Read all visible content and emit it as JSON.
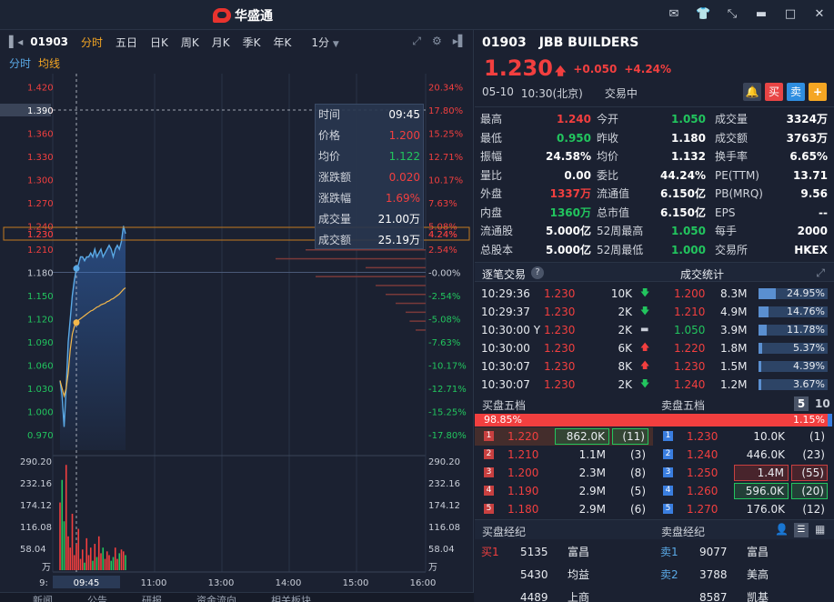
{
  "app": {
    "brand": "华盛通"
  },
  "window_icons": [
    "mail-icon",
    "shirt-icon",
    "shrink-icon",
    "minimize-icon",
    "maximize-icon",
    "close-icon"
  ],
  "toolbar": {
    "code": "01903",
    "tabs": [
      "分时",
      "五日",
      "日K",
      "周K",
      "月K",
      "季K",
      "年K"
    ],
    "active_tab": "分时",
    "interval": "1分"
  },
  "subtabs": {
    "primary": "分时",
    "secondary": "均线"
  },
  "tooltip": [
    {
      "k": "时间",
      "v": "09:45",
      "color": "#ffffff"
    },
    {
      "k": "价格",
      "v": "1.200",
      "color": "#f23f3f"
    },
    {
      "k": "均价",
      "v": "1.122",
      "color": "#22c55e"
    },
    {
      "k": "涨跌额",
      "v": "0.020",
      "color": "#f23f3f"
    },
    {
      "k": "涨跌幅",
      "v": "1.69%",
      "color": "#f23f3f"
    },
    {
      "k": "成交量",
      "v": "21.00万",
      "color": "#ffffff"
    },
    {
      "k": "成交额",
      "v": "25.19万",
      "color": "#ffffff"
    }
  ],
  "chart_data": {
    "type": "line",
    "title": "",
    "prev_close": 1.18,
    "ylim": [
      0.95,
      1.43
    ],
    "y_ticks_left": [
      "1.420",
      "1.390",
      "1.360",
      "1.330",
      "1.300",
      "1.270",
      "1.240",
      "1.230",
      "1.210",
      "1.180",
      "1.150",
      "1.120",
      "1.090",
      "1.060",
      "1.030",
      "1.000",
      "0.970"
    ],
    "y_ticks_right": [
      "20.34%",
      "17.80%",
      "15.25%",
      "12.71%",
      "10.17%",
      "7.63%",
      "5.08%",
      "4.24%",
      "2.54%",
      "-0.00%",
      "-2.54%",
      "-5.08%",
      "-7.63%",
      "-10.17%",
      "-12.71%",
      "-15.25%",
      "-17.80%"
    ],
    "x_ticks": [
      "9:",
      "09:45",
      "11:00",
      "13:00",
      "14:00",
      "15:00",
      "16:00"
    ],
    "crosshair_time": "09:45",
    "crosshair_price": "1.390",
    "last_price_label": "1.230",
    "last_pct_label": "4.24%",
    "series": [
      {
        "name": "价格",
        "values": [
          1.04,
          1.02,
          0.98,
          1.03,
          1.09,
          1.12,
          1.15,
          1.17,
          1.185,
          1.19,
          1.2,
          1.2,
          1.195,
          1.2,
          1.2,
          1.205,
          1.2,
          1.21,
          1.2,
          1.205,
          1.21,
          1.2,
          1.205,
          1.21,
          1.215,
          1.21,
          1.2,
          1.21,
          1.215,
          1.21,
          1.22,
          1.24,
          1.23
        ]
      },
      {
        "name": "均价",
        "values": [
          1.04,
          1.03,
          1.02,
          1.03,
          1.05,
          1.08,
          1.1,
          1.11,
          1.115,
          1.118,
          1.12,
          1.122,
          1.124,
          1.126,
          1.128,
          1.13,
          1.131,
          1.133,
          1.135,
          1.136,
          1.138,
          1.139,
          1.14,
          1.142,
          1.143,
          1.145,
          1.146,
          1.148,
          1.15,
          1.152,
          1.155,
          1.158,
          1.16
        ]
      }
    ],
    "volume": {
      "y_ticks": [
        "290.20",
        "232.16",
        "174.12",
        "116.08",
        "58.04",
        "万"
      ],
      "ymax": 290.2,
      "values": [
        180,
        240,
        130,
        280,
        90,
        60,
        150,
        40,
        70,
        110,
        30,
        55,
        20,
        85,
        40,
        60,
        25,
        70,
        35,
        90,
        45,
        60,
        30,
        50,
        40,
        25,
        35,
        60,
        30,
        45,
        55,
        50,
        40
      ]
    },
    "depth_ticks": [
      0.6,
      0.75,
      0.3,
      0.55,
      0.25,
      0.2,
      0.15,
      0.1,
      0.08,
      0.05
    ]
  },
  "bottom_tabs": [
    "新闻",
    "公告",
    "研报",
    "资金流向",
    "相关板块"
  ],
  "stock": {
    "code": "01903",
    "name": "JBB BUILDERS",
    "price": "1.230",
    "change": "+0.050",
    "pct": "+4.24%",
    "date": "05-10",
    "time": "10:30(北京)",
    "status": "交易中",
    "buy_label": "买",
    "sell_label": "卖",
    "add_label": "+"
  },
  "stats": [
    [
      {
        "k": "最高",
        "v": "1.240",
        "c": "#f23f3f"
      },
      {
        "k": "今开",
        "v": "1.050",
        "c": "#22c55e"
      },
      {
        "k": "成交量",
        "v": "3324万",
        "c": "#ffffff"
      }
    ],
    [
      {
        "k": "最低",
        "v": "0.950",
        "c": "#22c55e"
      },
      {
        "k": "昨收",
        "v": "1.180",
        "c": "#ffffff"
      },
      {
        "k": "成交额",
        "v": "3763万",
        "c": "#ffffff"
      }
    ],
    [
      {
        "k": "振幅",
        "v": "24.58%",
        "c": "#ffffff"
      },
      {
        "k": "均价",
        "v": "1.132",
        "c": "#ffffff"
      },
      {
        "k": "换手率",
        "v": "6.65%",
        "c": "#ffffff"
      }
    ],
    [
      {
        "k": "量比",
        "v": "0.00",
        "c": "#ffffff"
      },
      {
        "k": "委比",
        "v": "44.24%",
        "c": "#ffffff"
      },
      {
        "k": "PE(TTM)",
        "v": "13.71",
        "c": "#ffffff"
      }
    ],
    [
      {
        "k": "外盘",
        "v": "1337万",
        "c": "#f23f3f"
      },
      {
        "k": "流通值",
        "v": "6.150亿",
        "c": "#ffffff"
      },
      {
        "k": "PB(MRQ)",
        "v": "9.56",
        "c": "#ffffff"
      }
    ],
    [
      {
        "k": "内盘",
        "v": "1360万",
        "c": "#22c55e"
      },
      {
        "k": "总市值",
        "v": "6.150亿",
        "c": "#ffffff"
      },
      {
        "k": "EPS",
        "v": "--",
        "c": "#ffffff"
      }
    ],
    [
      {
        "k": "流通股",
        "v": "5.000亿",
        "c": "#ffffff"
      },
      {
        "k": "52周最高",
        "v": "1.050",
        "c": "#22c55e"
      },
      {
        "k": "每手",
        "v": "2000",
        "c": "#ffffff"
      }
    ],
    [
      {
        "k": "总股本",
        "v": "5.000亿",
        "c": "#ffffff"
      },
      {
        "k": "52周最低",
        "v": "1.000",
        "c": "#22c55e"
      },
      {
        "k": "交易所",
        "v": "HKEX",
        "c": "#ffffff"
      }
    ]
  ],
  "ticks_head": {
    "left": "逐笔交易",
    "right": "成交统计"
  },
  "ticks": [
    {
      "t": "10:29:36",
      "p": "1.230",
      "q": "10K",
      "dir": "down",
      "sp": "1.200",
      "spc": "#f23f3f",
      "sv": "8.3M",
      "pct": "24.95%",
      "frac": 0.2495
    },
    {
      "t": "10:29:37",
      "p": "1.230",
      "q": "2K",
      "dir": "down",
      "sp": "1.210",
      "spc": "#f23f3f",
      "sv": "4.9M",
      "pct": "14.76%",
      "frac": 0.1476
    },
    {
      "t": "10:30:00 Y",
      "p": "1.230",
      "q": "2K",
      "dir": "flat",
      "sp": "1.050",
      "spc": "#22c55e",
      "sv": "3.9M",
      "pct": "11.78%",
      "frac": 0.1178
    },
    {
      "t": "10:30:00",
      "p": "1.230",
      "q": "6K",
      "dir": "up",
      "sp": "1.220",
      "spc": "#f23f3f",
      "sv": "1.8M",
      "pct": "5.37%",
      "frac": 0.0537
    },
    {
      "t": "10:30:07",
      "p": "1.230",
      "q": "8K",
      "dir": "up",
      "sp": "1.230",
      "spc": "#f23f3f",
      "sv": "1.5M",
      "pct": "4.39%",
      "frac": 0.0439
    },
    {
      "t": "10:30:07",
      "p": "1.230",
      "q": "2K",
      "dir": "down",
      "sp": "1.240",
      "spc": "#f23f3f",
      "sv": "1.2M",
      "pct": "3.67%",
      "frac": 0.0367
    }
  ],
  "depth_head": {
    "bid": "买盘五档",
    "ask": "卖盘五档",
    "opt5": "5",
    "opt10": "10"
  },
  "ratio": {
    "bid_pct": "98.85%",
    "ask_pct": "1.15%",
    "bid_frac": 0.9885
  },
  "bids": [
    {
      "n": "1",
      "p": "1.220",
      "v": "862.0K",
      "c": "(11)",
      "box": true
    },
    {
      "n": "2",
      "p": "1.210",
      "v": "1.1M",
      "c": "(3)",
      "box": false
    },
    {
      "n": "3",
      "p": "1.200",
      "v": "2.3M",
      "c": "(8)",
      "box": false
    },
    {
      "n": "4",
      "p": "1.190",
      "v": "2.9M",
      "c": "(5)",
      "box": false
    },
    {
      "n": "5",
      "p": "1.180",
      "v": "2.9M",
      "c": "(6)",
      "box": false
    }
  ],
  "asks": [
    {
      "n": "1",
      "p": "1.230",
      "v": "10.0K",
      "c": "(1)",
      "box": ""
    },
    {
      "n": "2",
      "p": "1.240",
      "v": "446.0K",
      "c": "(23)",
      "box": ""
    },
    {
      "n": "3",
      "p": "1.250",
      "v": "1.4M",
      "c": "(55)",
      "box": "red"
    },
    {
      "n": "4",
      "p": "1.260",
      "v": "596.0K",
      "c": "(20)",
      "box": "green"
    },
    {
      "n": "5",
      "p": "1.270",
      "v": "176.0K",
      "c": "(12)",
      "box": ""
    }
  ],
  "broker_head": {
    "bid": "买盘经纪",
    "ask": "卖盘经纪"
  },
  "bid_brokers": [
    {
      "tag": "买1",
      "id": "5135",
      "name": "富昌"
    },
    {
      "tag": "",
      "id": "5430",
      "name": "均益"
    },
    {
      "tag": "",
      "id": "4489",
      "name": "上商"
    }
  ],
  "ask_brokers": [
    {
      "tag": "卖1",
      "id": "9077",
      "name": "富昌"
    },
    {
      "tag": "卖2",
      "id": "3788",
      "name": "美高"
    },
    {
      "tag": "",
      "id": "8587",
      "name": "凯基"
    }
  ],
  "colors": {
    "up": "#f23f3f",
    "down": "#22c55e",
    "accent": "#f5a623",
    "blue": "#3a7ee0"
  }
}
